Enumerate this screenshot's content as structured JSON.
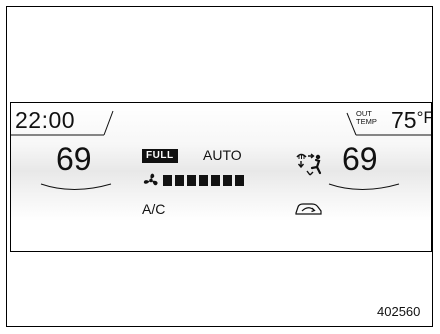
{
  "display": {
    "clock": "22:00",
    "outside": {
      "label_line1": "OUT",
      "label_line2": "TEMP",
      "value": "75",
      "unit": "°F"
    },
    "driver_temp": "69",
    "passenger_temp": "69",
    "fan_mode_badge": "FULL",
    "mode_label": "AUTO",
    "ac_label": "A/C",
    "fan_speed": {
      "level": 7,
      "max": 7
    },
    "icons": [
      "fan-icon",
      "defrost-airflow-icon",
      "recirculation-icon"
    ]
  },
  "figure_code": "402560"
}
